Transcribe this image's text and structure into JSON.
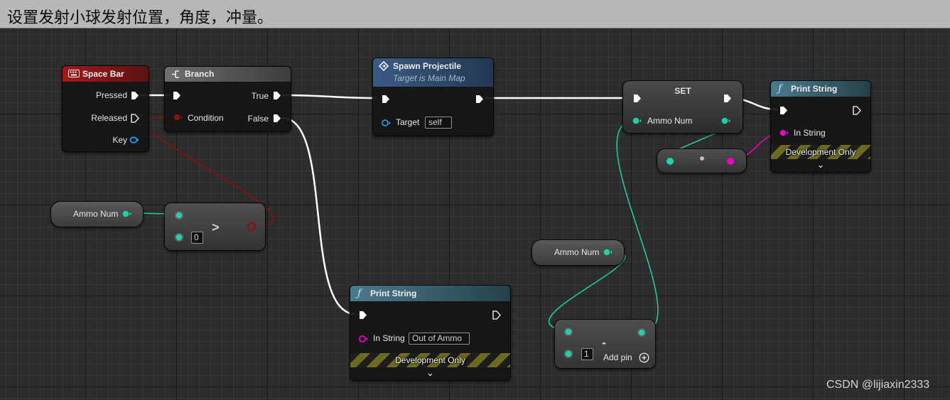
{
  "comment_title": "设置发射小球发射位置，角度，冲量。",
  "watermark": "CSDN @lijiaxin2333",
  "space_bar": {
    "title": "Space Bar",
    "pressed": "Pressed",
    "released": "Released",
    "key": "Key"
  },
  "branch": {
    "title": "Branch",
    "condition": "Condition",
    "true_label": "True",
    "false_label": "False"
  },
  "ammo_var_1": {
    "label": "Ammo Num"
  },
  "greater_node": {
    "symbol": ">",
    "value": "0"
  },
  "spawn": {
    "title": "Spawn Projectile",
    "subtitle": "Target is Main Map",
    "target_label": "Target",
    "target_value": "self"
  },
  "set_node": {
    "title": "SET",
    "pin_label": "Ammo Num"
  },
  "print_top": {
    "title": "Print String",
    "in_string_label": "In String",
    "dev_only": "Development Only"
  },
  "print_bottom": {
    "title": "Print String",
    "in_string_label": "In String",
    "in_string_value": "Out of Ammo",
    "dev_only": "Development Only"
  },
  "ammo_var_2": {
    "label": "Ammo Num"
  },
  "subtract_node": {
    "symbol": "-",
    "value": "1",
    "add_pin": "Add pin"
  },
  "colors": {
    "exec": "#ffffff",
    "bool": "#8c1010",
    "integer": "#1fd0a8",
    "string": "#f000c8",
    "struct": "#2a8fd6"
  }
}
